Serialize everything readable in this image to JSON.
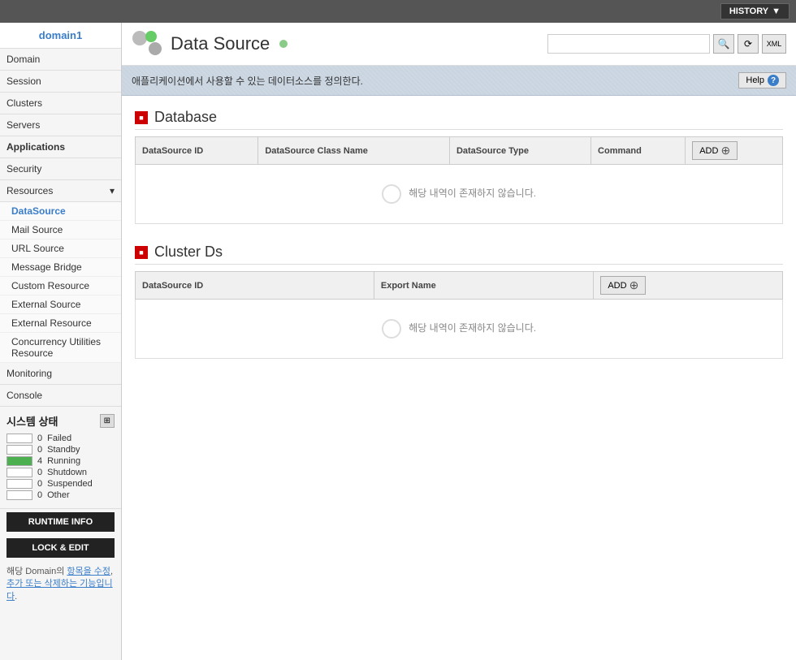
{
  "topbar": {
    "history_label": "HISTORY",
    "arrow": "▼"
  },
  "sidebar": {
    "domain_label": "domain1",
    "sections": [
      {
        "id": "domain",
        "label": "Domain"
      },
      {
        "id": "session",
        "label": "Session"
      },
      {
        "id": "clusters",
        "label": "Clusters"
      },
      {
        "id": "servers",
        "label": "Servers"
      },
      {
        "id": "applications",
        "label": "Applications"
      },
      {
        "id": "security",
        "label": "Security"
      },
      {
        "id": "resources",
        "label": "Resources",
        "has_arrow": true
      }
    ],
    "subsections": [
      {
        "id": "datasource",
        "label": "DataSource",
        "active": true
      },
      {
        "id": "mail-source",
        "label": "Mail Source"
      },
      {
        "id": "url-source",
        "label": "URL Source"
      },
      {
        "id": "message-bridge",
        "label": "Message Bridge"
      },
      {
        "id": "custom-resource",
        "label": "Custom Resource"
      },
      {
        "id": "external-source",
        "label": "External Source"
      },
      {
        "id": "external-resource",
        "label": "External Resource"
      },
      {
        "id": "concurrency",
        "label": "Concurrency Utilities Resource"
      }
    ],
    "monitoring_label": "Monitoring",
    "console_label": "Console",
    "system_status_title": "시스템 상태",
    "status_rows": [
      {
        "id": "failed",
        "count": "0",
        "label": "Failed",
        "running": false
      },
      {
        "id": "standby",
        "count": "0",
        "label": "Standby",
        "running": false
      },
      {
        "id": "running",
        "count": "4",
        "label": "Running",
        "running": true
      },
      {
        "id": "shutdown",
        "count": "0",
        "label": "Shutdown",
        "running": false
      },
      {
        "id": "suspended",
        "count": "0",
        "label": "Suspended",
        "running": false
      },
      {
        "id": "other",
        "count": "0",
        "label": "Other",
        "running": false
      }
    ],
    "runtime_info_btn": "RUNTIME INFO",
    "lock_edit_btn": "LOCK & EDIT",
    "note_html": "해당 Domain의 항목을 수정, 추가 또는 삭제하는 기능입니다."
  },
  "content": {
    "page_title": "Data Source",
    "info_text": "애플리케이션에서 사용할 수 있는 데이터소스를 정의한다.",
    "help_label": "Help",
    "search_placeholder": "",
    "database_section": {
      "title": "Database",
      "flag": "■",
      "columns": [
        "DataSource ID",
        "DataSource Class Name",
        "DataSource Type",
        "Command"
      ],
      "add_label": "ADD",
      "empty_text": "해당 내역이 존재하지 않습니다."
    },
    "cluster_section": {
      "title": "Cluster Ds",
      "flag": "■",
      "columns": [
        "DataSource ID",
        "Export Name"
      ],
      "add_label": "ADD",
      "empty_text": "해당 내역이 존재하지 않습니다."
    }
  }
}
